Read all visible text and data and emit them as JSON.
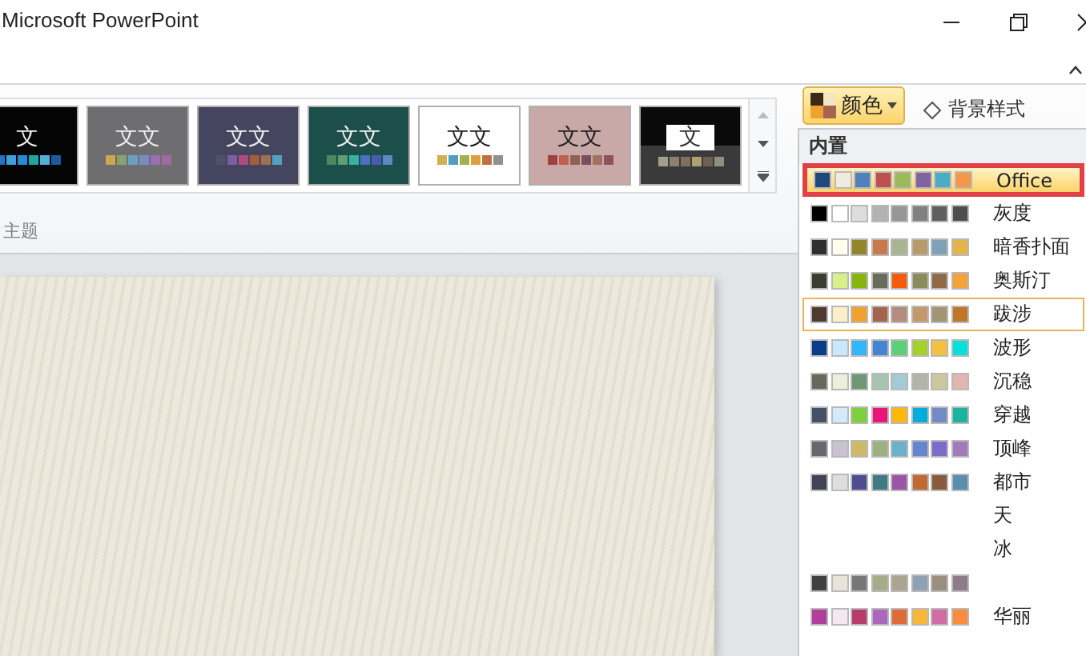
{
  "window": {
    "title": "Microsoft PowerPoint"
  },
  "themes": [
    {
      "kind": "plain",
      "text": "文",
      "color": "#050505",
      "swatches": [
        {
          "color": "#1f74c8"
        },
        {
          "color": "#3fa0d8"
        },
        {
          "color": "#2a8ad0"
        },
        {
          "color": "#1fa6a0"
        },
        {
          "color": "#4fb0d8"
        },
        {
          "color": "#1f5a9a"
        }
      ]
    },
    {
      "kind": "plain",
      "text": "文文",
      "color": "#6e6e70",
      "swatches": [
        {
          "color": "#c8a850"
        },
        {
          "color": "#8aa070"
        },
        {
          "color": "#6aa0c0"
        },
        {
          "color": "#7a8ac8"
        },
        {
          "color": "#9a70b0"
        },
        {
          "color": "#a06aa0"
        }
      ]
    },
    {
      "kind": "plain",
      "text": "文文",
      "color": "#454560",
      "swatches": [
        {
          "color": "#4a5070"
        },
        {
          "color": "#7a60a0"
        },
        {
          "color": "#b04a80"
        },
        {
          "color": "#a06040"
        },
        {
          "color": "#a07050"
        },
        {
          "color": "#50a0c0"
        }
      ]
    },
    {
      "kind": "plain",
      "text": "文文",
      "color": "#1d4f4a",
      "swatches": [
        {
          "color": "#4a8a5a"
        },
        {
          "color": "#5aa070"
        },
        {
          "color": "#3ab0a0"
        },
        {
          "color": "#4a70c0"
        },
        {
          "color": "#4a5ab0"
        },
        {
          "color": "#5a8ac0"
        }
      ]
    },
    {
      "kind": "plain",
      "text": "文文",
      "color": "#ffffff",
      "swatches": [
        {
          "color": "#d0b050"
        },
        {
          "color": "#50a0c0"
        },
        {
          "color": "#a0b050"
        },
        {
          "color": "#e0a040"
        },
        {
          "color": "#c07040"
        },
        {
          "color": "#909090"
        }
      ]
    },
    {
      "kind": "plain",
      "text": "文文",
      "color": "#c9a9a8",
      "swatches": [
        {
          "color": "#a04040"
        },
        {
          "color": "#c06050"
        },
        {
          "color": "#906050"
        },
        {
          "color": "#7a5060"
        },
        {
          "color": "#a07060"
        },
        {
          "color": "#905060"
        }
      ]
    },
    {
      "kind": "boxed",
      "text": "文",
      "color": "#0a0a0a",
      "swatches": [
        {
          "color": "#a0a090"
        },
        {
          "color": "#908070"
        },
        {
          "color": "#807060"
        },
        {
          "color": "#b0a070"
        },
        {
          "color": "#706050"
        },
        {
          "color": "#909080"
        }
      ]
    }
  ],
  "group_label": "主题",
  "colors_button": {
    "label": "颜色",
    "open": true
  },
  "background_styles": {
    "label": "背景样式"
  },
  "dropdown": {
    "heading": "内置",
    "schemes": [
      {
        "name": "Office",
        "selected": true,
        "current": false,
        "highlighted": true,
        "swatches": [
          {
            "color": "#1f497d"
          },
          {
            "color": "#eeece1"
          },
          {
            "color": "#4f81bd"
          },
          {
            "color": "#c0504d"
          },
          {
            "color": "#9bbb59"
          },
          {
            "color": "#8064a2"
          },
          {
            "color": "#4bacc6"
          },
          {
            "color": "#f79646"
          }
        ]
      },
      {
        "name": "灰度",
        "selected": false,
        "current": false,
        "highlighted": false,
        "swatches": [
          {
            "color": "#000000"
          },
          {
            "color": "#ffffff"
          },
          {
            "color": "#dddddd"
          },
          {
            "color": "#b2b2b2"
          },
          {
            "color": "#969696"
          },
          {
            "color": "#808080"
          },
          {
            "color": "#5f5f5f"
          },
          {
            "color": "#4d4d4d"
          }
        ]
      },
      {
        "name": "暗香扑面",
        "selected": false,
        "current": false,
        "highlighted": false,
        "swatches": [
          {
            "color": "#2f2f2f"
          },
          {
            "color": "#fffff0"
          },
          {
            "color": "#93852a"
          },
          {
            "color": "#c8794d"
          },
          {
            "color": "#a9b490"
          },
          {
            "color": "#b89a6c"
          },
          {
            "color": "#7ea1b8"
          },
          {
            "color": "#e4b34a"
          }
        ]
      },
      {
        "name": "奥斯汀",
        "selected": false,
        "current": false,
        "highlighted": false,
        "swatches": [
          {
            "color": "#3a3d2f"
          },
          {
            "color": "#d8f08a"
          },
          {
            "color": "#86b50c"
          },
          {
            "color": "#676c5d"
          },
          {
            "color": "#f55b0a"
          },
          {
            "color": "#8c8c5a"
          },
          {
            "color": "#8f6a45"
          },
          {
            "color": "#f5a23a"
          }
        ]
      },
      {
        "name": "跋涉",
        "selected": false,
        "current": true,
        "highlighted": false,
        "swatches": [
          {
            "color": "#4e3b30"
          },
          {
            "color": "#fbeec9"
          },
          {
            "color": "#f0a22e"
          },
          {
            "color": "#a5644e"
          },
          {
            "color": "#b58b80"
          },
          {
            "color": "#c3986d"
          },
          {
            "color": "#a19574"
          },
          {
            "color": "#c17529"
          }
        ]
      },
      {
        "name": "波形",
        "selected": false,
        "current": false,
        "highlighted": false,
        "swatches": [
          {
            "color": "#073e87"
          },
          {
            "color": "#c6e7fc"
          },
          {
            "color": "#31b6fd"
          },
          {
            "color": "#4584d3"
          },
          {
            "color": "#5bd078"
          },
          {
            "color": "#a5d028"
          },
          {
            "color": "#f5c040"
          },
          {
            "color": "#05e0db"
          }
        ]
      },
      {
        "name": "沉稳",
        "selected": false,
        "current": false,
        "highlighted": false,
        "swatches": [
          {
            "color": "#656a5c"
          },
          {
            "color": "#eeeedd"
          },
          {
            "color": "#6f9773"
          },
          {
            "color": "#a6c4b0"
          },
          {
            "color": "#a3cbd6"
          },
          {
            "color": "#b3b3a9"
          },
          {
            "color": "#cbc79e"
          },
          {
            "color": "#dfb6b1"
          }
        ]
      },
      {
        "name": "穿越",
        "selected": false,
        "current": false,
        "highlighted": false,
        "swatches": [
          {
            "color": "#465167"
          },
          {
            "color": "#d4eafb"
          },
          {
            "color": "#7ed03c"
          },
          {
            "color": "#ea157a"
          },
          {
            "color": "#feb80a"
          },
          {
            "color": "#00addc"
          },
          {
            "color": "#738ac8"
          },
          {
            "color": "#1ab39f"
          }
        ]
      },
      {
        "name": "顶峰",
        "selected": false,
        "current": false,
        "highlighted": false,
        "swatches": [
          {
            "color": "#69676d"
          },
          {
            "color": "#c9c2d1"
          },
          {
            "color": "#ceb966"
          },
          {
            "color": "#9cb084"
          },
          {
            "color": "#6bb1c9"
          },
          {
            "color": "#6585cf"
          },
          {
            "color": "#7e6bc9"
          },
          {
            "color": "#a379bb"
          }
        ]
      },
      {
        "name": "都市",
        "selected": false,
        "current": false,
        "highlighted": false,
        "swatches": [
          {
            "color": "#424456"
          },
          {
            "color": "#dedede"
          },
          {
            "color": "#4f4c8f"
          },
          {
            "color": "#3f7a85"
          },
          {
            "color": "#9b54a6"
          },
          {
            "color": "#c06a31"
          },
          {
            "color": "#8a5a3d"
          },
          {
            "color": "#5a8eb0"
          }
        ]
      },
      {
        "name": "天",
        "selected": false,
        "current": false,
        "highlighted": false
      },
      {
        "name": "冰",
        "selected": false,
        "current": false,
        "highlighted": false
      },
      {
        "selected": false,
        "current": false,
        "highlighted": false,
        "swatches": [
          {
            "color": "#404040"
          },
          {
            "color": "#e8e4d8"
          },
          {
            "color": "#777777"
          },
          {
            "color": "#a5ad88"
          },
          {
            "color": "#aba590"
          },
          {
            "color": "#8ea2b3"
          },
          {
            "color": "#9c8e7e"
          },
          {
            "color": "#8f7a8a"
          }
        ]
      },
      {
        "name": "华丽",
        "selected": false,
        "current": false,
        "highlighted": false,
        "swatches": [
          {
            "color": "#b13f9a"
          },
          {
            "color": "#f4e7ed"
          },
          {
            "color": "#b83d68"
          },
          {
            "color": "#ac66bb"
          },
          {
            "color": "#de6c36"
          },
          {
            "color": "#f9b639"
          },
          {
            "color": "#cf6da4"
          },
          {
            "color": "#fa8d3d"
          }
        ]
      }
    ]
  }
}
